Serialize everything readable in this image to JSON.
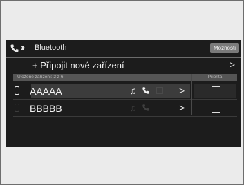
{
  "header": {
    "title": "Bluetooth",
    "options_label": "Možnosti"
  },
  "add_device": {
    "label": "+ Připojit nové zařízení",
    "chevron": ">"
  },
  "list_header": {
    "saved_label": "Uložené zařízení: 2 z 6",
    "priority_label": "Priorita"
  },
  "devices": [
    {
      "name": "AAAAA",
      "note_icon": "♫",
      "chevron": ">",
      "active": true
    },
    {
      "name": "BBBBB",
      "note_icon": "♫",
      "chevron": ">",
      "active": false
    }
  ],
  "icons": {
    "phone": "phone-icon",
    "double_chevron": "double-chevron-icon",
    "music": "music-note-icon",
    "play": "play-icon",
    "device": "smartphone-icon"
  },
  "colors": {
    "screen_bg": "#1c1c1c",
    "text": "#f2f2f2",
    "options_button": "#7a7a7a"
  }
}
